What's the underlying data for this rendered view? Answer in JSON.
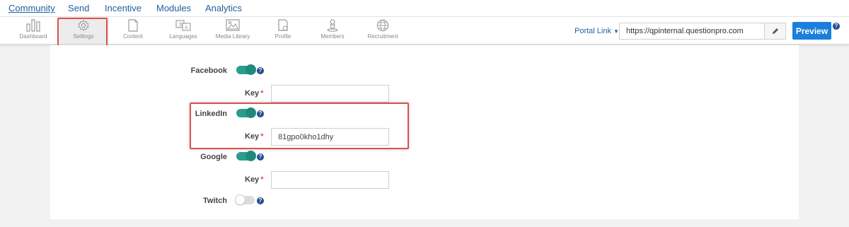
{
  "topnav": {
    "tabs": [
      {
        "label": "Community",
        "active": true
      },
      {
        "label": "Send"
      },
      {
        "label": "Incentive"
      },
      {
        "label": "Modules"
      },
      {
        "label": "Analytics"
      }
    ]
  },
  "toolbar": {
    "items": [
      {
        "label": "Dashboard",
        "icon": "bar-chart-icon"
      },
      {
        "label": "Settings",
        "icon": "gear-icon",
        "selected": true
      },
      {
        "label": "Content",
        "icon": "document-icon"
      },
      {
        "label": "Languages",
        "icon": "translate-icon"
      },
      {
        "label": "Media Library",
        "icon": "image-icon"
      },
      {
        "label": "Profile",
        "icon": "profile-document-icon"
      },
      {
        "label": "Members",
        "icon": "person-icon"
      },
      {
        "label": "Recruitment",
        "icon": "globe-icon"
      }
    ],
    "portal_link_label": "Portal Link",
    "portal_url": "https://qpinternal.questionpro.com",
    "preview_label": "Preview"
  },
  "social": {
    "facebook": {
      "label": "Facebook",
      "enabled": true,
      "key_label": "Key",
      "key_value": ""
    },
    "linkedin": {
      "label": "LinkedIn",
      "enabled": true,
      "key_label": "Key",
      "key_value": "81gpo0kho1dhy"
    },
    "google": {
      "label": "Google",
      "enabled": true,
      "key_label": "Key",
      "key_value": ""
    },
    "twitch": {
      "label": "Twitch",
      "enabled": false
    }
  },
  "colors": {
    "link": "#1f5f9e",
    "toggle_on": "#2a9d8f",
    "highlight": "#d9534f",
    "primary_button": "#1a7fdb",
    "required": "#d9534f"
  }
}
